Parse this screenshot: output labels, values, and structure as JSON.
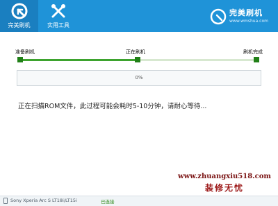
{
  "header": {
    "tabs": [
      {
        "label": "完美刷机",
        "icon": "refresh-icon",
        "active": true
      },
      {
        "label": "实用工具",
        "icon": "tools-icon",
        "active": false
      }
    ],
    "brand": {
      "name": "完美刷机",
      "url": "www.wmshua.com",
      "icon": "brand-logo-icon"
    }
  },
  "steps": {
    "labels": [
      "准备刷机",
      "正在刷机",
      "刷机完成"
    ],
    "current_step_fraction": 0.5
  },
  "progress": {
    "value": 0,
    "label": "0%"
  },
  "message": "正在扫描ROM文件，此过程可能会耗时5-10分钟，请耐心等待...",
  "watermark": {
    "url": "www.zhuangxiu518.com",
    "name": "装修无忧"
  },
  "statusbar": {
    "device": "Sony Xperia Arc S LT18i/LT15i",
    "connection": "已连接",
    "icon": "phone-icon"
  },
  "colors": {
    "header_blue": "#1f93d8",
    "active_tab": "#1a7fc0",
    "progress_green": "#3da32e",
    "step_dot": "#218018"
  }
}
